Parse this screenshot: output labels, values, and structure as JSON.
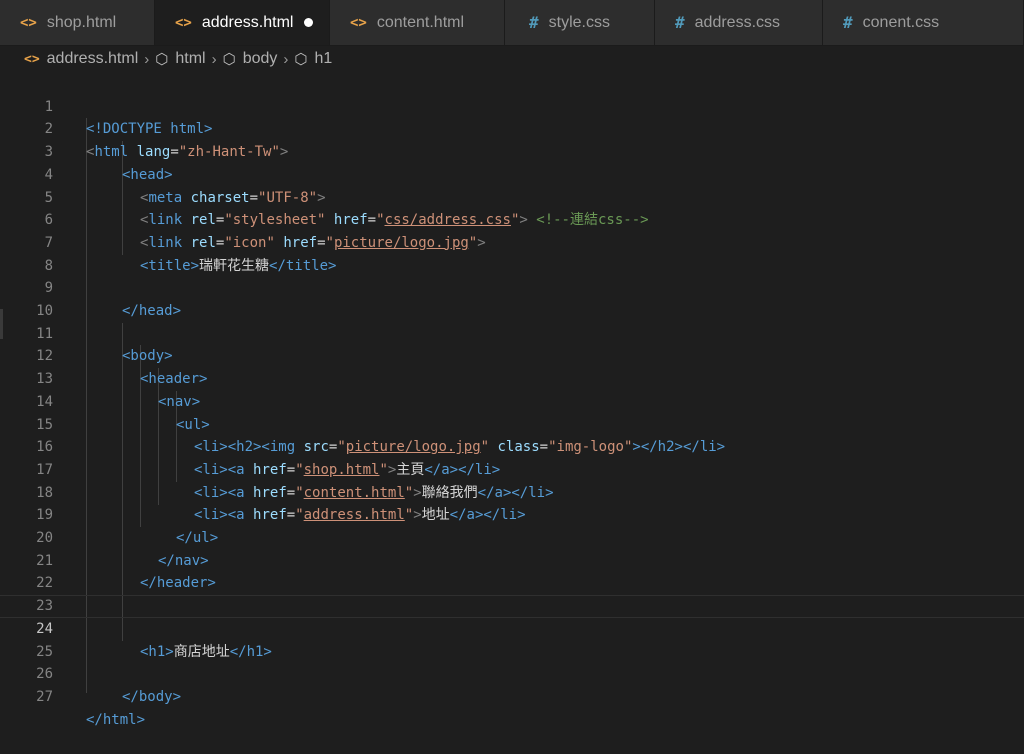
{
  "tabs": [
    {
      "label": "shop.html",
      "icon": "html-file-icon",
      "glyph": "<>",
      "active": false
    },
    {
      "label": "address.html",
      "icon": "html-file-icon",
      "glyph": "<>",
      "active": true,
      "dirty": true
    },
    {
      "label": "content.html",
      "icon": "html-file-icon",
      "glyph": "<>",
      "active": false
    },
    {
      "label": "style.css",
      "icon": "css-file-icon",
      "glyph": "#",
      "active": false
    },
    {
      "label": "address.css",
      "icon": "css-file-icon",
      "glyph": "#",
      "active": false
    },
    {
      "label": "conent.css",
      "icon": "css-file-icon",
      "glyph": "#",
      "active": false
    }
  ],
  "breadcrumb": [
    "address.html",
    "html",
    "body",
    "h1"
  ],
  "editor": {
    "current_line": 24,
    "lines": [
      {
        "n": "1"
      },
      {
        "n": "2"
      },
      {
        "n": "3"
      },
      {
        "n": "4"
      },
      {
        "n": "5"
      },
      {
        "n": "6"
      },
      {
        "n": "7"
      },
      {
        "n": "8"
      },
      {
        "n": "9"
      },
      {
        "n": "10"
      },
      {
        "n": "11"
      },
      {
        "n": "12"
      },
      {
        "n": "13"
      },
      {
        "n": "14"
      },
      {
        "n": "15"
      },
      {
        "n": "16"
      },
      {
        "n": "17"
      },
      {
        "n": "18"
      },
      {
        "n": "19"
      },
      {
        "n": "20"
      },
      {
        "n": "21"
      },
      {
        "n": "22"
      },
      {
        "n": "23"
      },
      {
        "n": "24"
      },
      {
        "n": "25"
      },
      {
        "n": "26"
      },
      {
        "n": "27"
      }
    ],
    "code": {
      "doctype": "<!DOCTYPE html>",
      "html_open_tag": "html",
      "lang_attr": "lang",
      "lang_value": "\"zh-Hant-Tw\"",
      "head_open": "<head>",
      "meta_tag": "meta",
      "charset_attr": "charset",
      "charset_value": "\"UTF-8\"",
      "link_tag": "link",
      "rel_attr": "rel",
      "stylesheet_value": "\"stylesheet\"",
      "href_attr": "href",
      "css_href": "css/address.css",
      "comment": "<!--連結css-->",
      "icon_value": "\"icon\"",
      "logo_href": "picture/logo.jpg",
      "title_open": "<title>",
      "title_text": "瑞軒花生糖",
      "title_close": "</title>",
      "head_close": "</head>",
      "body_open": "<body>",
      "header_open": "<header>",
      "nav_open": "<nav>",
      "ul_open": "<ul>",
      "li_h2_open": "<li><h2><",
      "img_tag": "img",
      "src_attr": "src",
      "img_src": "picture/logo.jpg",
      "class_attr": "class",
      "img_class": "\"img-logo\"",
      "li_h2_close": "></h2></li>",
      "li_a_open": "<li><",
      "a_tag": "a",
      "shop_href": "shop.html",
      "shop_text": "主頁",
      "content_href": "content.html",
      "content_text": "聯絡我們",
      "address_href": "address.html",
      "address_text": "地址",
      "a_li_close": "</a></li>",
      "ul_close": "</ul>",
      "nav_close": "</nav>",
      "header_close": "</header>",
      "h1_open": "<h1>",
      "h1_text": "商店地址",
      "h1_close": "</h1>",
      "body_close": "</body>",
      "html_close": "</html>"
    }
  }
}
